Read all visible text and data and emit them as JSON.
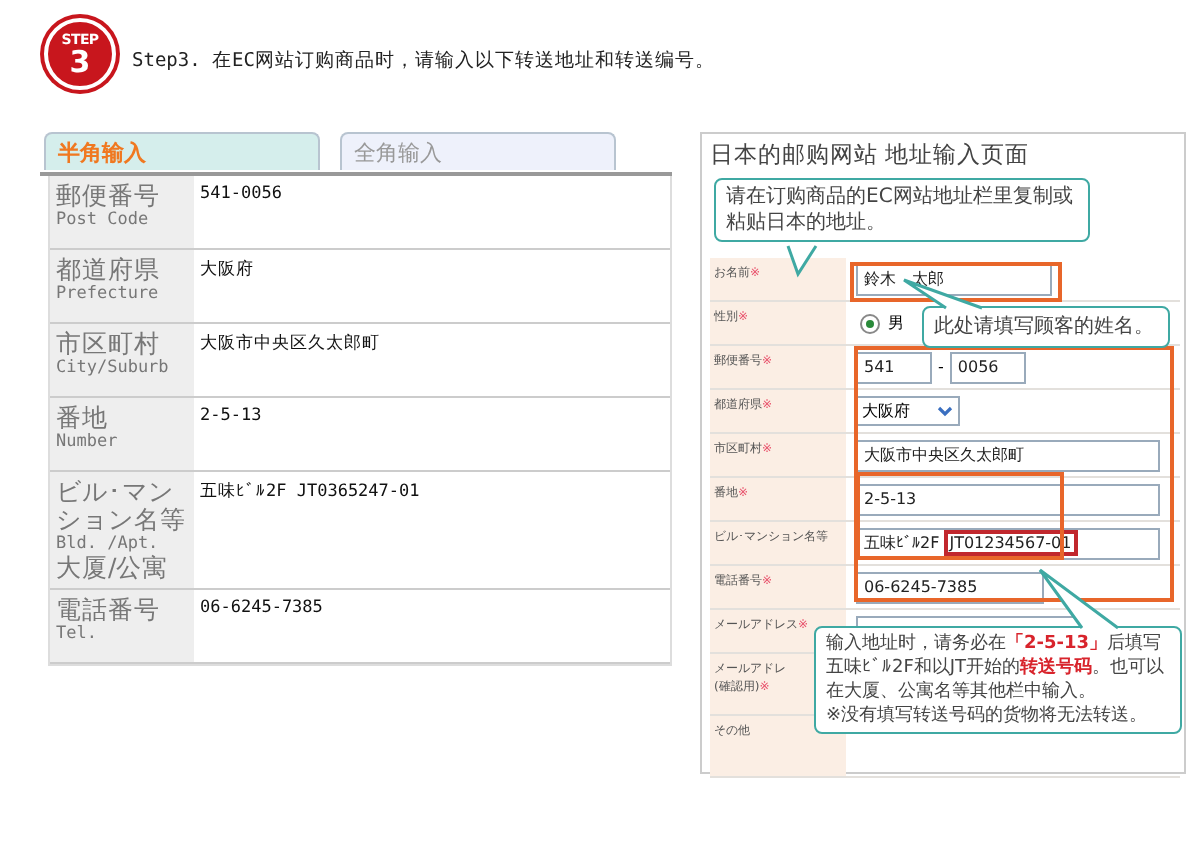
{
  "header": {
    "badge": {
      "word": "STEP",
      "number": "3"
    },
    "title": "Step3. 在EC网站订购商品时，请输入以下转送地址和转送编号。"
  },
  "tabs": [
    {
      "label": "半角输入",
      "selected": true
    },
    {
      "label": "全角输入",
      "selected": false
    }
  ],
  "address_table": [
    {
      "label": "郵便番号",
      "sub": [
        "Post Code"
      ],
      "value": "541-0056"
    },
    {
      "label": "都道府県",
      "sub": [
        "Prefecture"
      ],
      "value": "大阪府"
    },
    {
      "label": "市区町村",
      "sub": [
        "City/Suburb"
      ],
      "value": "大阪市中央区久太郎町"
    },
    {
      "label": "番地",
      "sub": [
        "Number"
      ],
      "value": "2-5-13"
    },
    {
      "label": "ビル･マンション名等",
      "sub": [
        "Bld. /Apt.",
        "大厦/公寓"
      ],
      "value": "五味ﾋﾞﾙ2F JT0365247-01"
    },
    {
      "label": "電話番号",
      "sub": [
        "Tel."
      ],
      "value": "06-6245-7385"
    }
  ],
  "example_form": {
    "title": "日本的邮购网站 地址输入页面",
    "rows": [
      {
        "label": "お名前",
        "mark": "※",
        "kind": "text",
        "value": "鈴木　太郎"
      },
      {
        "label": "性別",
        "mark": "※",
        "kind": "radio",
        "options": [
          {
            "label": "男",
            "selected": true
          }
        ]
      },
      {
        "label": "郵便番号",
        "mark": "※",
        "kind": "postal",
        "parts": [
          "541",
          "0056"
        ],
        "separator": "-"
      },
      {
        "label": "都道府県",
        "mark": "※",
        "kind": "select",
        "value": "大阪府"
      },
      {
        "label": "市区町村",
        "mark": "※",
        "kind": "text",
        "value": "大阪市中央区久太郎町"
      },
      {
        "label": "番地",
        "mark": "※",
        "kind": "text",
        "value": "2-5-13"
      },
      {
        "label": "ビル･マンション名等",
        "kind": "text",
        "value": "五味ﾋﾞﾙ2F",
        "code": "JT01234567-01"
      },
      {
        "label": "電話番号",
        "mark": "※",
        "kind": "text",
        "value": "06-6245-7385"
      },
      {
        "label": "メールアドレス",
        "mark": "※",
        "kind": "text"
      },
      {
        "label": "メールアドレ",
        "label_line2": "(確認用)",
        "mark": "※",
        "kind": "blank"
      },
      {
        "label": "その他",
        "kind": "blank"
      }
    ],
    "callouts": [
      {
        "lines": [
          "请在订购商品的EC网站地址栏里复制或粘贴日本的地址。"
        ]
      },
      {
        "lines": [
          "此处请填写顾客的姓名。"
        ]
      },
      {
        "lines": [
          "输入地址时，请务必在**「2-5-13」**后填写五味ﾋﾞﾙ2F和以JT开始的**转送号码**。也可以在大厦、公寓名等其他栏中输入。",
          "※没有填写转送号码的货物将无法转送。"
        ]
      }
    ]
  }
}
